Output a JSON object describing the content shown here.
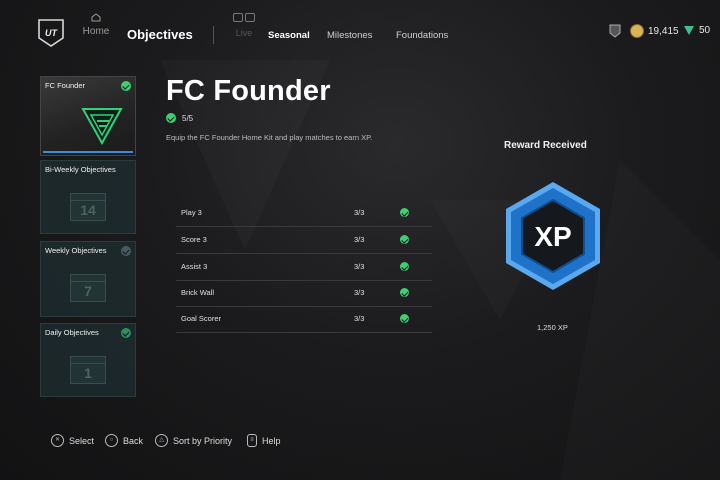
{
  "nav": {
    "home_label": "Home",
    "title": "Objectives",
    "live_label": "Live",
    "tabs": [
      {
        "label": "Seasonal",
        "active": true
      },
      {
        "label": "Milestones",
        "active": false
      },
      {
        "label": "Foundations",
        "active": false
      }
    ]
  },
  "currencies": [
    {
      "icon": "trophy-icon",
      "value": ""
    },
    {
      "icon": "coin-icon",
      "value": "19,415",
      "color": "#d9b45a"
    },
    {
      "icon": "fc-points-icon",
      "value": "50",
      "color": "#3fbf8e"
    }
  ],
  "sidebar": {
    "items": [
      {
        "label": "FC Founder",
        "completed": true
      },
      {
        "label": "Bi-Weekly Objectives",
        "number": "14"
      },
      {
        "label": "Weekly Objectives",
        "number": "7"
      },
      {
        "label": "Daily Objectives",
        "number": "1"
      }
    ]
  },
  "main": {
    "title": "FC Founder",
    "progress": "5/5",
    "description": "Equip the FC Founder Home Kit and play matches to earn XP.",
    "objectives": [
      {
        "name": "Play 3",
        "value": "3/3"
      },
      {
        "name": "Score 3",
        "value": "3/3"
      },
      {
        "name": "Assist 3",
        "value": "3/3"
      },
      {
        "name": "Brick Wall",
        "value": "3/3"
      },
      {
        "name": "Goal Scorer",
        "value": "3/3"
      }
    ]
  },
  "reward": {
    "title": "Reward Received",
    "badge_text": "XP",
    "amount": "1,250 XP",
    "badge_color": "#1e72c8"
  },
  "footer": [
    {
      "icon": "cross-button-icon",
      "label": "Select"
    },
    {
      "icon": "circle-button-icon",
      "label": "Back"
    },
    {
      "icon": "triangle-button-icon",
      "label": "Sort by Priority"
    },
    {
      "icon": "options-button-icon",
      "label": "Help"
    }
  ],
  "colors": {
    "accent_green": "#3ecf6e",
    "accent_blue": "#3f8bd6"
  }
}
